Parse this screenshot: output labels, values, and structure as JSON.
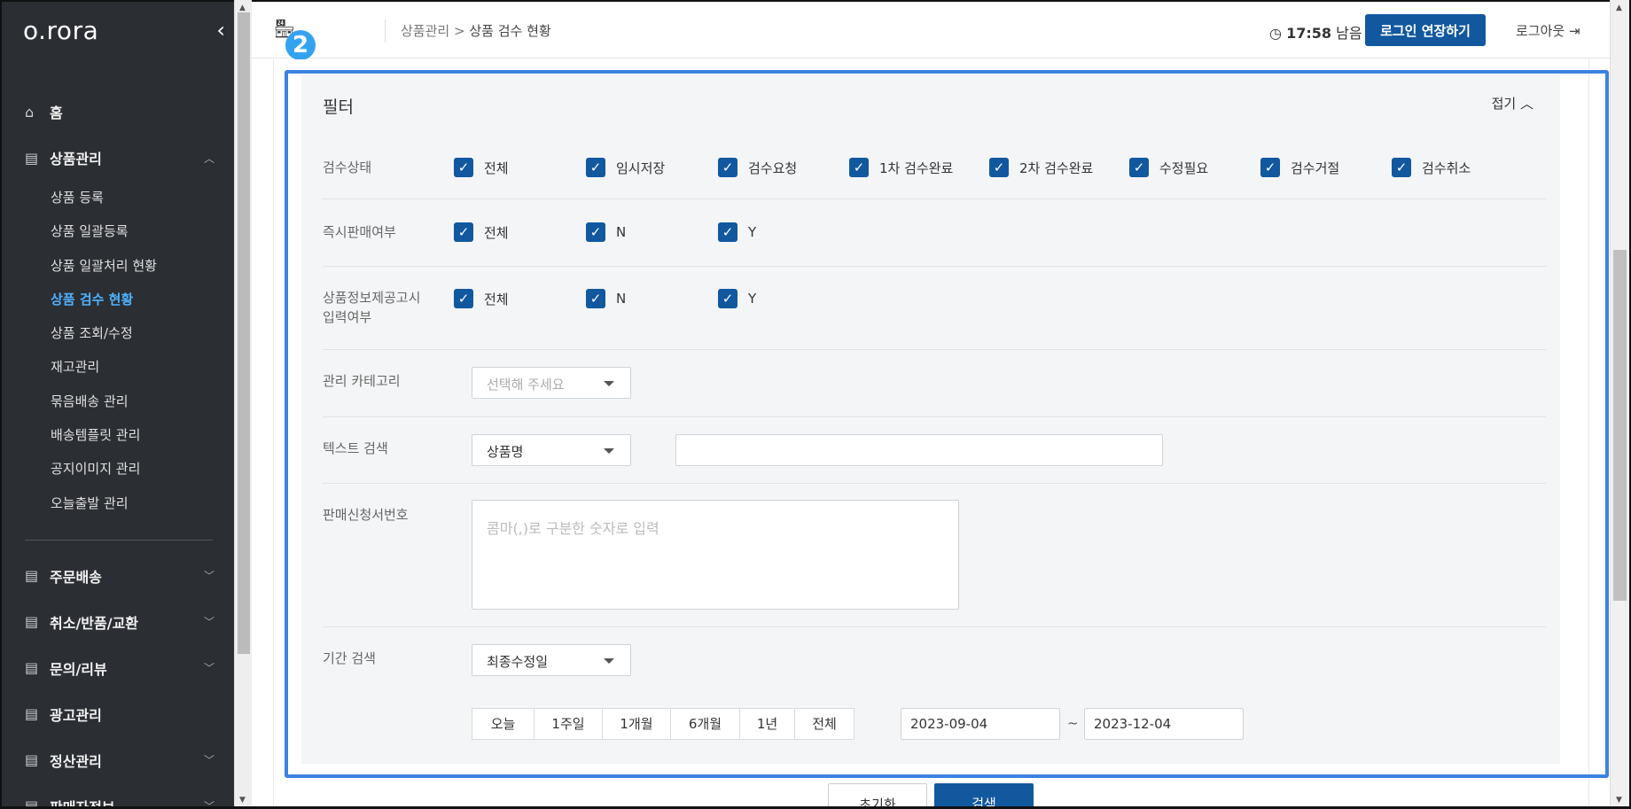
{
  "sidebar": {
    "logo": "o.rora",
    "collapse_icon": "‹",
    "items": [
      {
        "label": "홈",
        "icon": "home-icon"
      },
      {
        "label": "상품관리",
        "icon": "document-icon",
        "expanded": true
      },
      {
        "label": "주문배송",
        "icon": "document-icon"
      },
      {
        "label": "취소/반품/교환",
        "icon": "document-icon"
      },
      {
        "label": "문의/리뷰",
        "icon": "document-icon"
      },
      {
        "label": "광고관리",
        "icon": "document-icon"
      },
      {
        "label": "정산관리",
        "icon": "document-icon"
      },
      {
        "label": "판매자정보",
        "icon": "document-icon"
      }
    ],
    "sub_items": [
      "상품 등록",
      "상품 일괄등록",
      "상품 일괄처리 현황",
      "상품 검수 현황",
      "상품 조회/수정",
      "재고관리",
      "묶음배송 관리",
      "배송템플릿 관리",
      "공지이미지 관리",
      "오늘출발 관리"
    ],
    "active_sub": "상품 검수 현황"
  },
  "topbar": {
    "badge": "2",
    "breadcrumb_parent": "상품관리",
    "breadcrumb_sep": ">",
    "breadcrumb_current": "상품 검수 현황",
    "timer_time": "17:58",
    "timer_suffix": "남음",
    "extend_button": "로그인 연장하기",
    "logout": "로그아웃"
  },
  "filter": {
    "title": "필터",
    "fold_label": "접기",
    "inspection_status": {
      "label": "검수상태",
      "options": [
        "전체",
        "임시저장",
        "검수요청",
        "1차 검수완료",
        "2차 검수완료",
        "수정필요",
        "검수거절",
        "검수취소"
      ]
    },
    "instant_sale": {
      "label": "즉시판매여부",
      "options": [
        "전체",
        "N",
        "Y"
      ]
    },
    "product_info_notice": {
      "label_line1": "상품정보제공고시",
      "label_line2": "입력여부",
      "options": [
        "전체",
        "N",
        "Y"
      ]
    },
    "category": {
      "label": "관리 카테고리",
      "placeholder": "선택해 주세요"
    },
    "text_search": {
      "label": "텍스트 검색",
      "selected": "상품명",
      "value": ""
    },
    "application_number": {
      "label": "판매신청서번호",
      "placeholder": "콤마(,)로 구분한 숫자로 입력"
    },
    "period": {
      "label": "기간 검색",
      "selected": "최종수정일",
      "buttons": [
        "오늘",
        "1주일",
        "1개월",
        "6개월",
        "1년",
        "전체"
      ],
      "start_date": "2023-09-04",
      "tilde": "~",
      "end_date": "2023-12-04"
    }
  },
  "actions": {
    "reset": "초기화",
    "search": "검색"
  }
}
